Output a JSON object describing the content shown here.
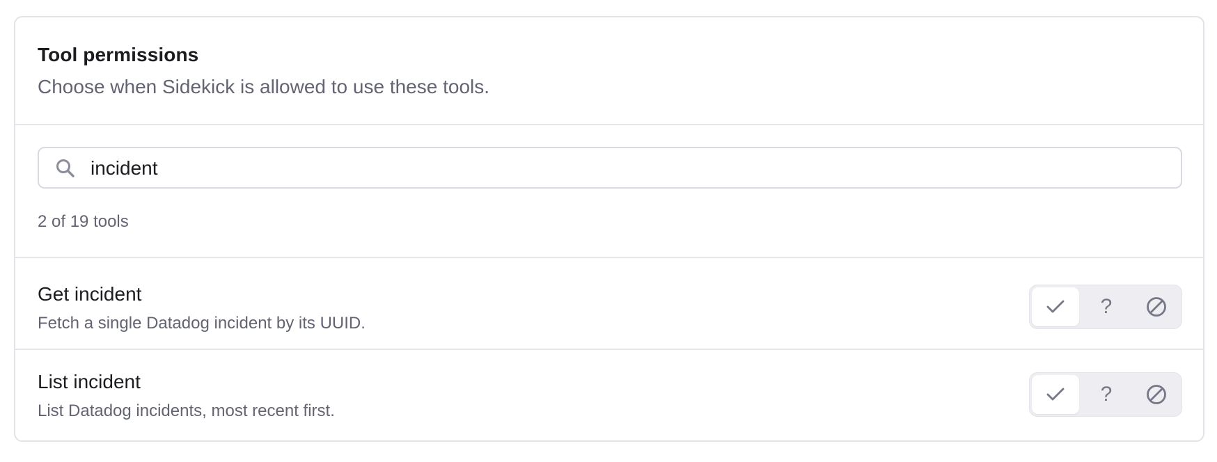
{
  "panel": {
    "title": "Tool permissions",
    "subtitle": "Choose when Sidekick is allowed to use these tools."
  },
  "search": {
    "icon": "search-icon",
    "value": "incident"
  },
  "results": {
    "count_text": "2 of 19 tools"
  },
  "tools": [
    {
      "name": "Get incident",
      "description": "Fetch a single Datadog incident by its UUID.",
      "permission": "allow",
      "options": [
        "check-icon",
        "question-icon",
        "block-icon"
      ]
    },
    {
      "name": "List incident",
      "description": "List Datadog incidents, most recent first.",
      "permission": "allow",
      "options": [
        "check-icon",
        "question-icon",
        "block-icon"
      ]
    }
  ],
  "colors": {
    "border": "#e2e3e8",
    "muted_text": "#626472",
    "segment_bg": "#eeeef2",
    "icon_gray": "#767887"
  }
}
